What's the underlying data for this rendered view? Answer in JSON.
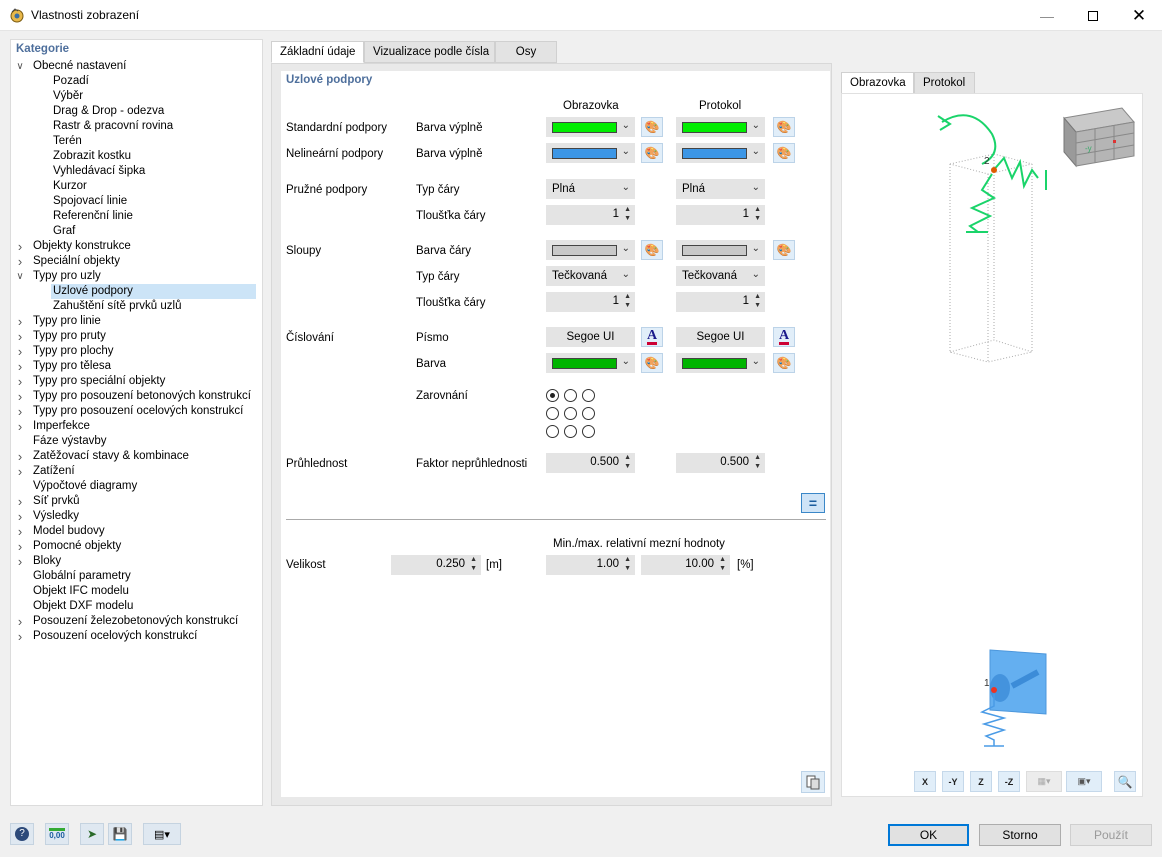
{
  "window": {
    "title": "Vlastnosti zobrazení"
  },
  "sidebar": {
    "header": "Kategorie",
    "items": [
      {
        "label": "Obecné nastavení",
        "level": 0,
        "expand": "open"
      },
      {
        "label": "Pozadí",
        "level": 1
      },
      {
        "label": "Výběr",
        "level": 1
      },
      {
        "label": "Drag & Drop - odezva",
        "level": 1
      },
      {
        "label": "Rastr & pracovní rovina",
        "level": 1
      },
      {
        "label": "Terén",
        "level": 1
      },
      {
        "label": "Zobrazit kostku",
        "level": 1
      },
      {
        "label": "Vyhledávací šipka",
        "level": 1
      },
      {
        "label": "Kurzor",
        "level": 1
      },
      {
        "label": "Spojovací linie",
        "level": 1
      },
      {
        "label": "Referenční linie",
        "level": 1
      },
      {
        "label": "Graf",
        "level": 1
      },
      {
        "label": "Objekty konstrukce",
        "level": 0,
        "expand": "closed"
      },
      {
        "label": "Speciální objekty",
        "level": 0,
        "expand": "closed"
      },
      {
        "label": "Typy pro uzly",
        "level": 0,
        "expand": "open"
      },
      {
        "label": "Uzlové podpory",
        "level": 1,
        "selected": true
      },
      {
        "label": "Zahuštění sítě prvků uzlů",
        "level": 1
      },
      {
        "label": "Typy pro linie",
        "level": 0,
        "expand": "closed"
      },
      {
        "label": "Typy pro pruty",
        "level": 0,
        "expand": "closed"
      },
      {
        "label": "Typy pro plochy",
        "level": 0,
        "expand": "closed"
      },
      {
        "label": "Typy pro tělesa",
        "level": 0,
        "expand": "closed"
      },
      {
        "label": "Typy pro speciální objekty",
        "level": 0,
        "expand": "closed"
      },
      {
        "label": "Typy pro posouzení betonových konstrukcí",
        "level": 0,
        "expand": "closed"
      },
      {
        "label": "Typy pro posouzení ocelových konstrukcí",
        "level": 0,
        "expand": "closed"
      },
      {
        "label": "Imperfekce",
        "level": 0,
        "expand": "closed"
      },
      {
        "label": "Fáze výstavby",
        "level": 0,
        "expand": "none"
      },
      {
        "label": "Zatěžovací stavy & kombinace",
        "level": 0,
        "expand": "closed"
      },
      {
        "label": "Zatížení",
        "level": 0,
        "expand": "closed"
      },
      {
        "label": "Výpočtové diagramy",
        "level": 0,
        "expand": "none"
      },
      {
        "label": "Síť prvků",
        "level": 0,
        "expand": "closed"
      },
      {
        "label": "Výsledky",
        "level": 0,
        "expand": "closed"
      },
      {
        "label": "Model budovy",
        "level": 0,
        "expand": "closed"
      },
      {
        "label": "Pomocné objekty",
        "level": 0,
        "expand": "closed"
      },
      {
        "label": "Bloky",
        "level": 0,
        "expand": "closed"
      },
      {
        "label": "Globální parametry",
        "level": 0,
        "expand": "none"
      },
      {
        "label": "Objekt IFC modelu",
        "level": 0,
        "expand": "none"
      },
      {
        "label": "Objekt DXF modelu",
        "level": 0,
        "expand": "none"
      },
      {
        "label": "Posouzení železobetonových konstrukcí",
        "level": 0,
        "expand": "closed"
      },
      {
        "label": "Posouzení ocelových konstrukcí",
        "level": 0,
        "expand": "closed"
      }
    ]
  },
  "tabs": [
    "Základní údaje",
    "Vizualizace podle čísla",
    "Osy"
  ],
  "section": {
    "title": "Uzlové podpory",
    "col_screen": "Obrazovka",
    "col_protocol": "Protokol",
    "standard": {
      "group": "Standardní podpory",
      "label": "Barva výplně",
      "screen_color": "#00ee00",
      "protocol_color": "#00ee00"
    },
    "nonlinear": {
      "group": "Nelineární podpory",
      "label": "Barva výplně",
      "screen_color": "#3c96e6",
      "protocol_color": "#3c96e6"
    },
    "elastic": {
      "group": "Pružné podpory",
      "line_type_label": "Typ čáry",
      "line_type_screen": "Plná",
      "line_type_protocol": "Plná",
      "thickness_label": "Tloušťka čáry",
      "thickness_screen": "1",
      "thickness_protocol": "1"
    },
    "columns": {
      "group": "Sloupy",
      "color_label": "Barva čáry",
      "screen_color": "#c8c8c8",
      "protocol_color": "#c8c8c8",
      "line_type_label": "Typ čáry",
      "line_type_screen": "Tečkovaná",
      "line_type_protocol": "Tečkovaná",
      "thickness_label": "Tloušťka čáry",
      "thickness_screen": "1",
      "thickness_protocol": "1"
    },
    "numbering": {
      "group": "Číslování",
      "font_label": "Písmo",
      "font_screen": "Segoe UI",
      "font_protocol": "Segoe UI",
      "color_label": "Barva",
      "screen_color": "#00b400",
      "protocol_color": "#00b400",
      "align_label": "Zarovnání"
    },
    "transparency": {
      "group": "Průhlednost",
      "label": "Faktor neprůhlednosti",
      "screen": "0.500",
      "protocol": "0.500"
    },
    "size": {
      "label": "Velikost",
      "value": "0.250",
      "unit": "[m]",
      "minmax_label": "Min./max. relativní mezní hodnoty",
      "min": "1.00",
      "max": "10.00",
      "pct_unit": "[%]"
    }
  },
  "preview": {
    "tabs": [
      "Obrazovka",
      "Protokol"
    ],
    "node_labels": [
      "2",
      "1"
    ],
    "cube_label": "-y"
  },
  "preview_toolbar": [
    "X",
    "-Y",
    "Z",
    "-Z"
  ],
  "footer": {
    "ok": "OK",
    "cancel": "Storno",
    "apply": "Použít",
    "units_label": "0,00"
  }
}
